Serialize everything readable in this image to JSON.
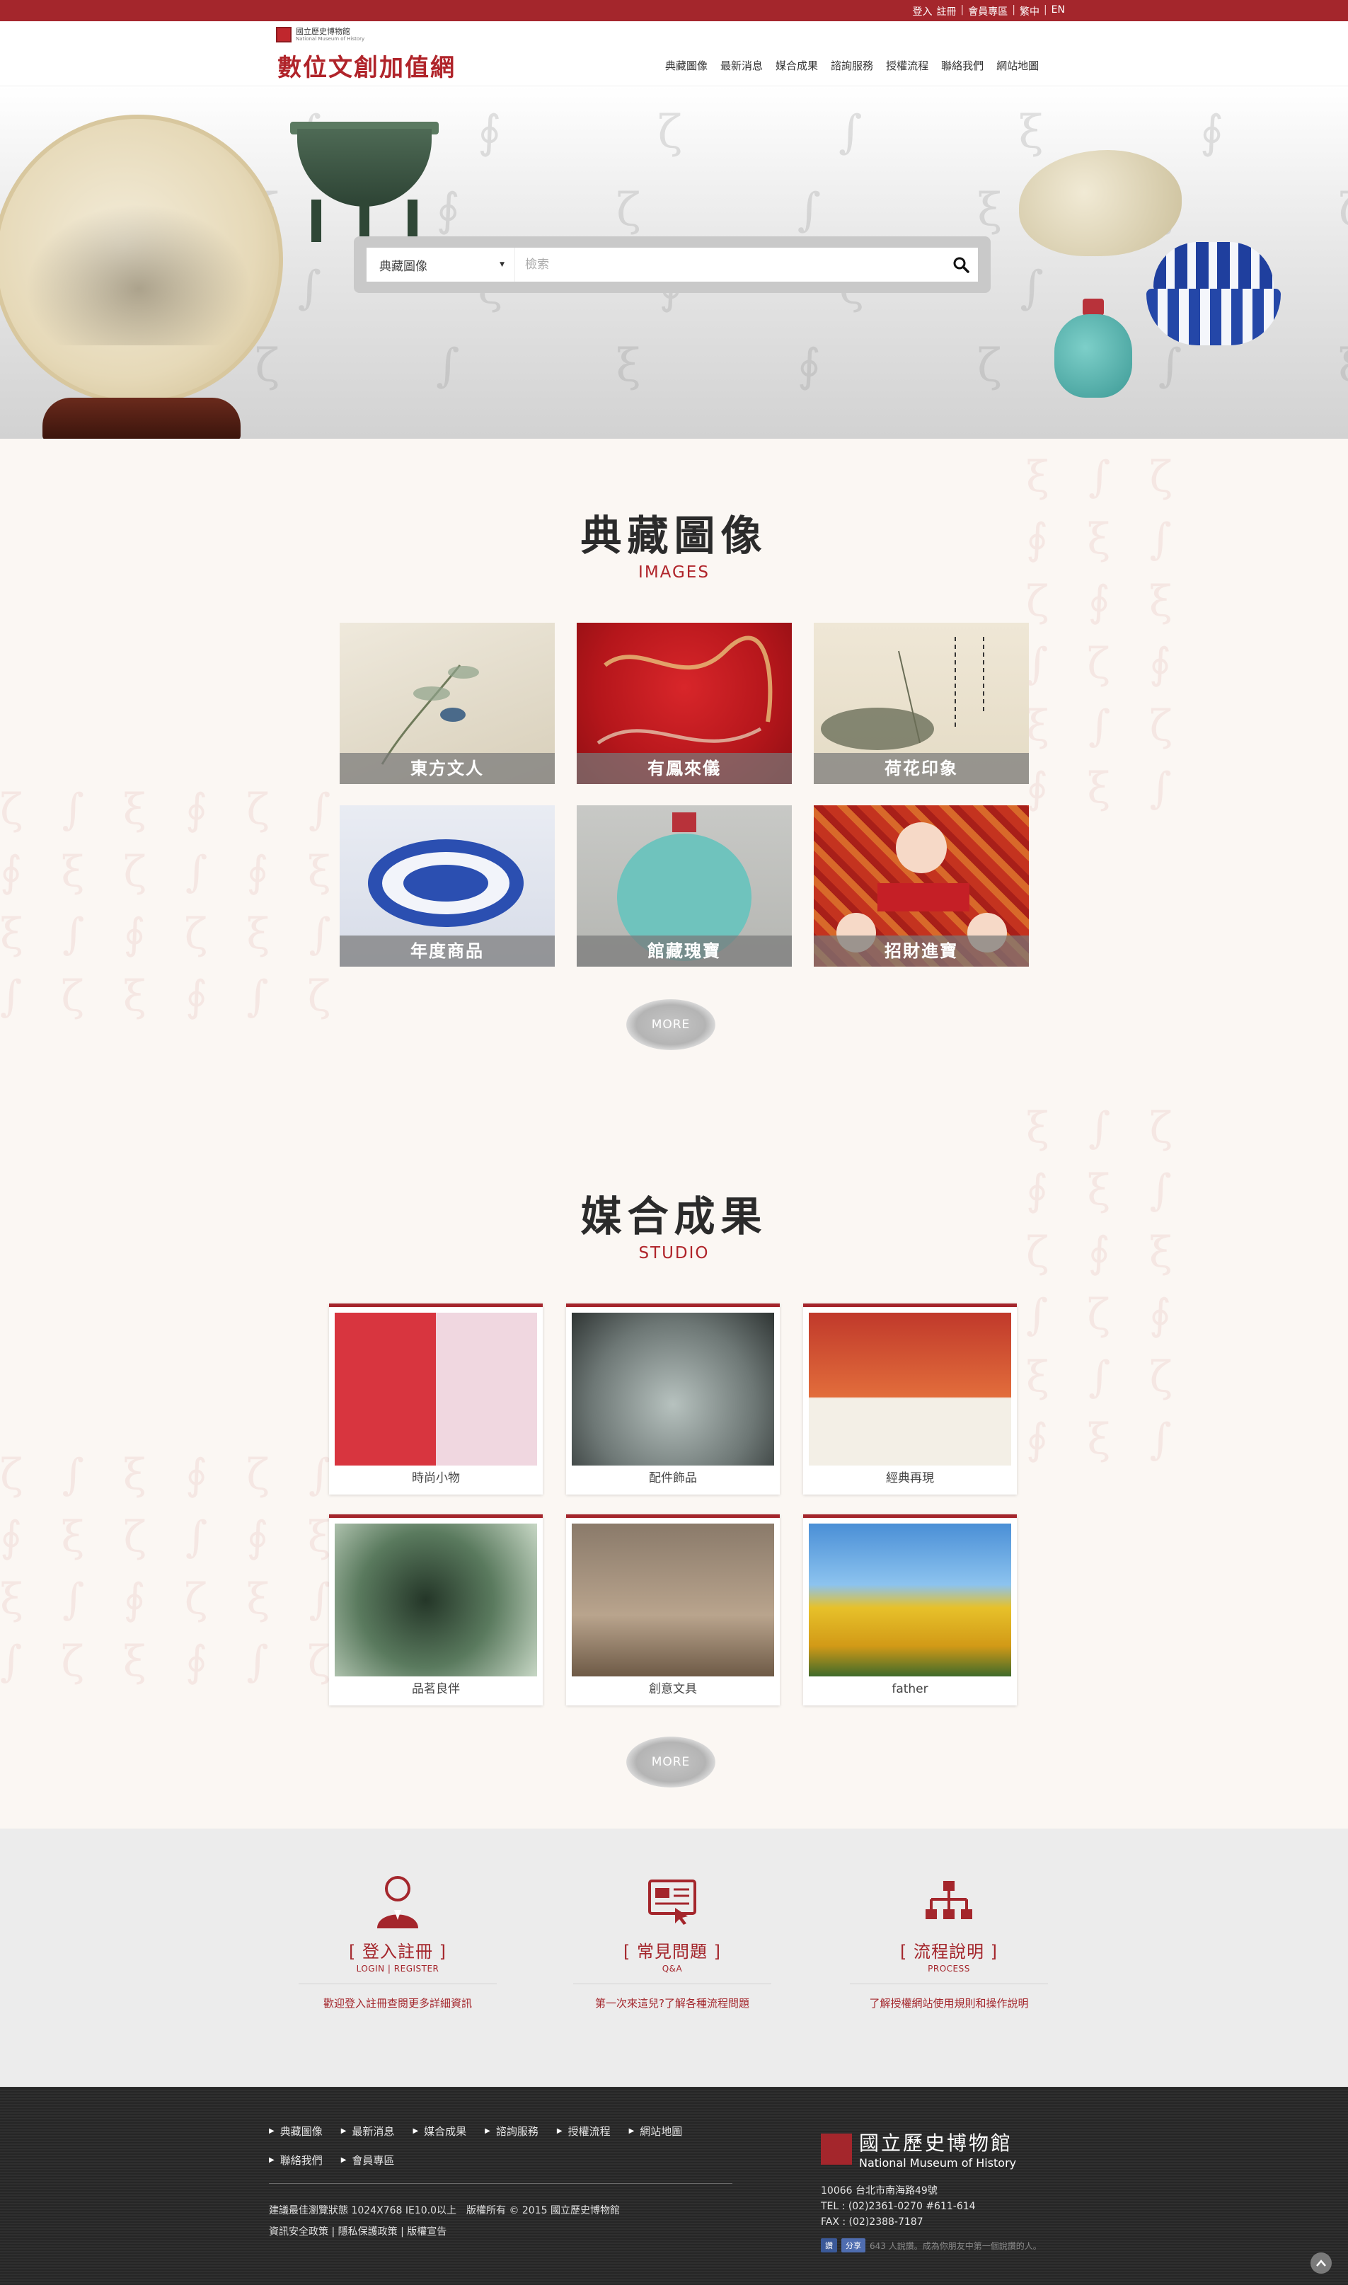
{
  "topbar": {
    "links": [
      "登入",
      "註冊",
      "會員專區",
      "繁中",
      "EN"
    ]
  },
  "header": {
    "small_logo_zh": "國立歷史博物館",
    "small_logo_en": "National Museum of History",
    "site_title": "數位文創加值網",
    "nav": [
      "典藏圖像",
      "最新消息",
      "媒合成果",
      "諮詢服務",
      "授權流程",
      "聯絡我們",
      "網站地圖"
    ]
  },
  "search": {
    "category": "典藏圖像",
    "placeholder": "檢索"
  },
  "images_section": {
    "title_zh": "典藏圖像",
    "title_en": "IMAGES",
    "items": [
      {
        "label": "東方文人"
      },
      {
        "label": "有鳳來儀"
      },
      {
        "label": "荷花印象"
      },
      {
        "label": "年度商品"
      },
      {
        "label": "館藏瑰寶"
      },
      {
        "label": "招財進寶"
      }
    ],
    "more": "MORE"
  },
  "studio_section": {
    "title_zh": "媒合成果",
    "title_en": "STUDIO",
    "items": [
      {
        "label": "時尚小物"
      },
      {
        "label": "配件飾品"
      },
      {
        "label": "經典再現"
      },
      {
        "label": "品茗良伴"
      },
      {
        "label": "創意文具"
      },
      {
        "label": "father"
      }
    ],
    "more": "MORE"
  },
  "features": [
    {
      "icon": "user-icon",
      "title": "[ 登入註冊 ]",
      "sub": "LOGIN | REGISTER",
      "desc": "歡迎登入註冊查閱更多詳細資訊"
    },
    {
      "icon": "faq-icon",
      "title": "[ 常見問題 ]",
      "sub": "Q&A",
      "desc": "第一次來這兒?了解各種流程問題"
    },
    {
      "icon": "flowchart-icon",
      "title": "[ 流程說明 ]",
      "sub": "PROCESS",
      "desc": "了解授權網站使用規則和操作說明"
    }
  ],
  "footer": {
    "nav": [
      "典藏圖像",
      "最新消息",
      "媒合成果",
      "諮詢服務",
      "授權流程",
      "網站地圖",
      "聯絡我們",
      "會員專區"
    ],
    "copyright": "建議最佳瀏覽狀態 1024X768 IE10.0以上　版權所有 © 2015 國立歷史博物館",
    "policy_links": [
      "資訊安全政策",
      "隱私保護政策",
      "版權宣告"
    ],
    "museum_zh": "國立歷史博物館",
    "museum_en": "National Museum of History",
    "address": "10066 台北市南海路49號",
    "tel": "TEL : (02)2361-0270 #611-614",
    "fax": "FAX : (02)2388-7187",
    "fb_like": "讚",
    "share": "分享",
    "fb_text": "643 人說讚。成為你朋友中第一個說讚的人。"
  },
  "colors": {
    "brand_red": "#a4262c",
    "footer_bg": "#2f2f2f",
    "feature_bg": "#ececec"
  }
}
